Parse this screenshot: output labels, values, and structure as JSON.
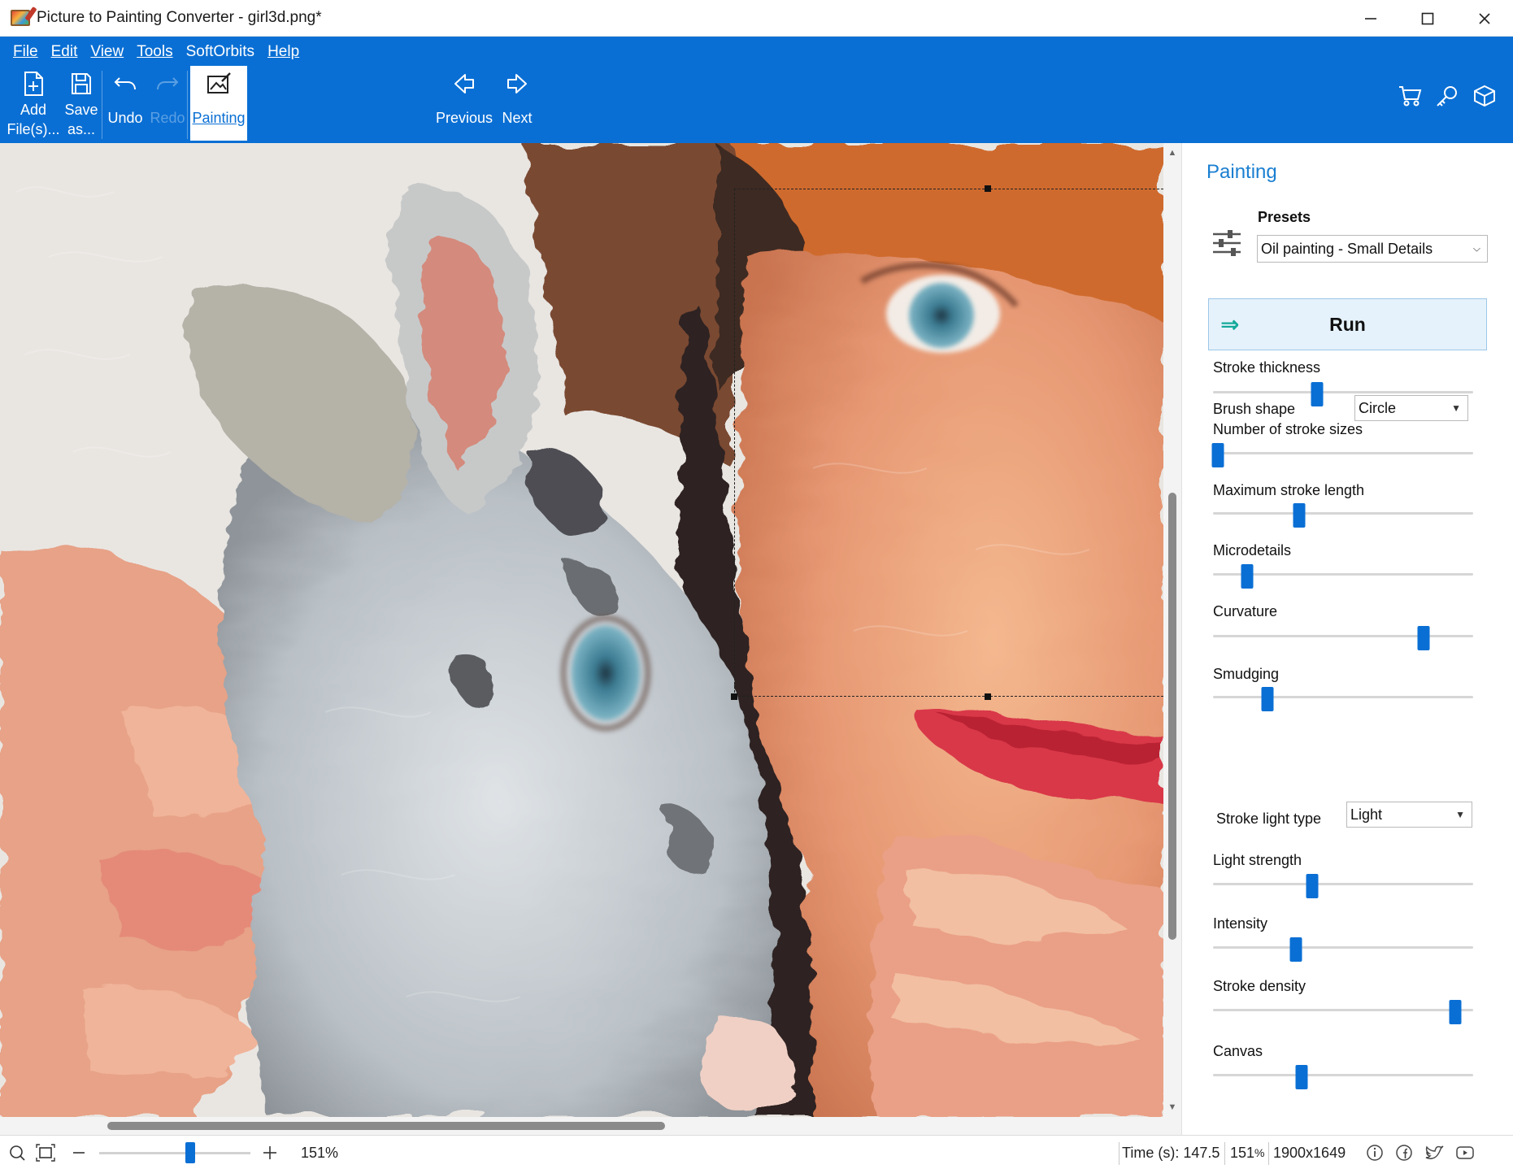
{
  "window": {
    "title": "Picture to Painting Converter - girl3d.png*",
    "controls": {
      "minimize": "—",
      "maximize": "☐",
      "close": "✕"
    }
  },
  "menu": [
    "File",
    "Edit",
    "View",
    "Tools",
    "SoftOrbits",
    "Help"
  ],
  "toolbar": {
    "add_label_1": "Add",
    "add_label_2": "File(s)...",
    "save_label_1": "Save",
    "save_label_2": "as...",
    "undo_label": "Undo",
    "redo_label": "Redo",
    "painting_label": "Painting",
    "previous_label": "Previous",
    "next_label": "Next",
    "right_icons": [
      "cart-icon",
      "key-icon",
      "box-icon"
    ]
  },
  "panel": {
    "title": "Painting",
    "presets_label": "Presets",
    "preset_value": "Oil painting - Small Details",
    "run_label": "Run",
    "brush_shape_label": "Brush shape",
    "brush_shape_value": "Circle",
    "stroke_light_type_label": "Stroke light type",
    "stroke_light_type_value": "Light",
    "sliders": [
      {
        "label": "Stroke thickness",
        "value": 0.4
      },
      {
        "label": "Number of stroke sizes",
        "value": 0.02
      },
      {
        "label": "Maximum stroke length",
        "value": 0.33
      },
      {
        "label": "Microdetails",
        "value": 0.13
      },
      {
        "label": "Curvature",
        "value": 0.81
      },
      {
        "label": "Smudging",
        "value": 0.21
      },
      {
        "label": "Light strength",
        "value": 0.38
      },
      {
        "label": "Intensity",
        "value": 0.32
      },
      {
        "label": "Stroke density",
        "value": 0.93
      },
      {
        "label": "Canvas",
        "value": 0.34
      }
    ]
  },
  "status": {
    "zoom_text": "151%",
    "zoom_slider": 0.6,
    "time_text": "Time (s): 147.5",
    "zoom_short": "151",
    "zoom_short_unit": "%",
    "dimensions": "1900x1649"
  },
  "colors": {
    "accent": "#0a6fd4",
    "panel_title": "#1a7fd1",
    "run_bg": "#e6f2fb"
  }
}
